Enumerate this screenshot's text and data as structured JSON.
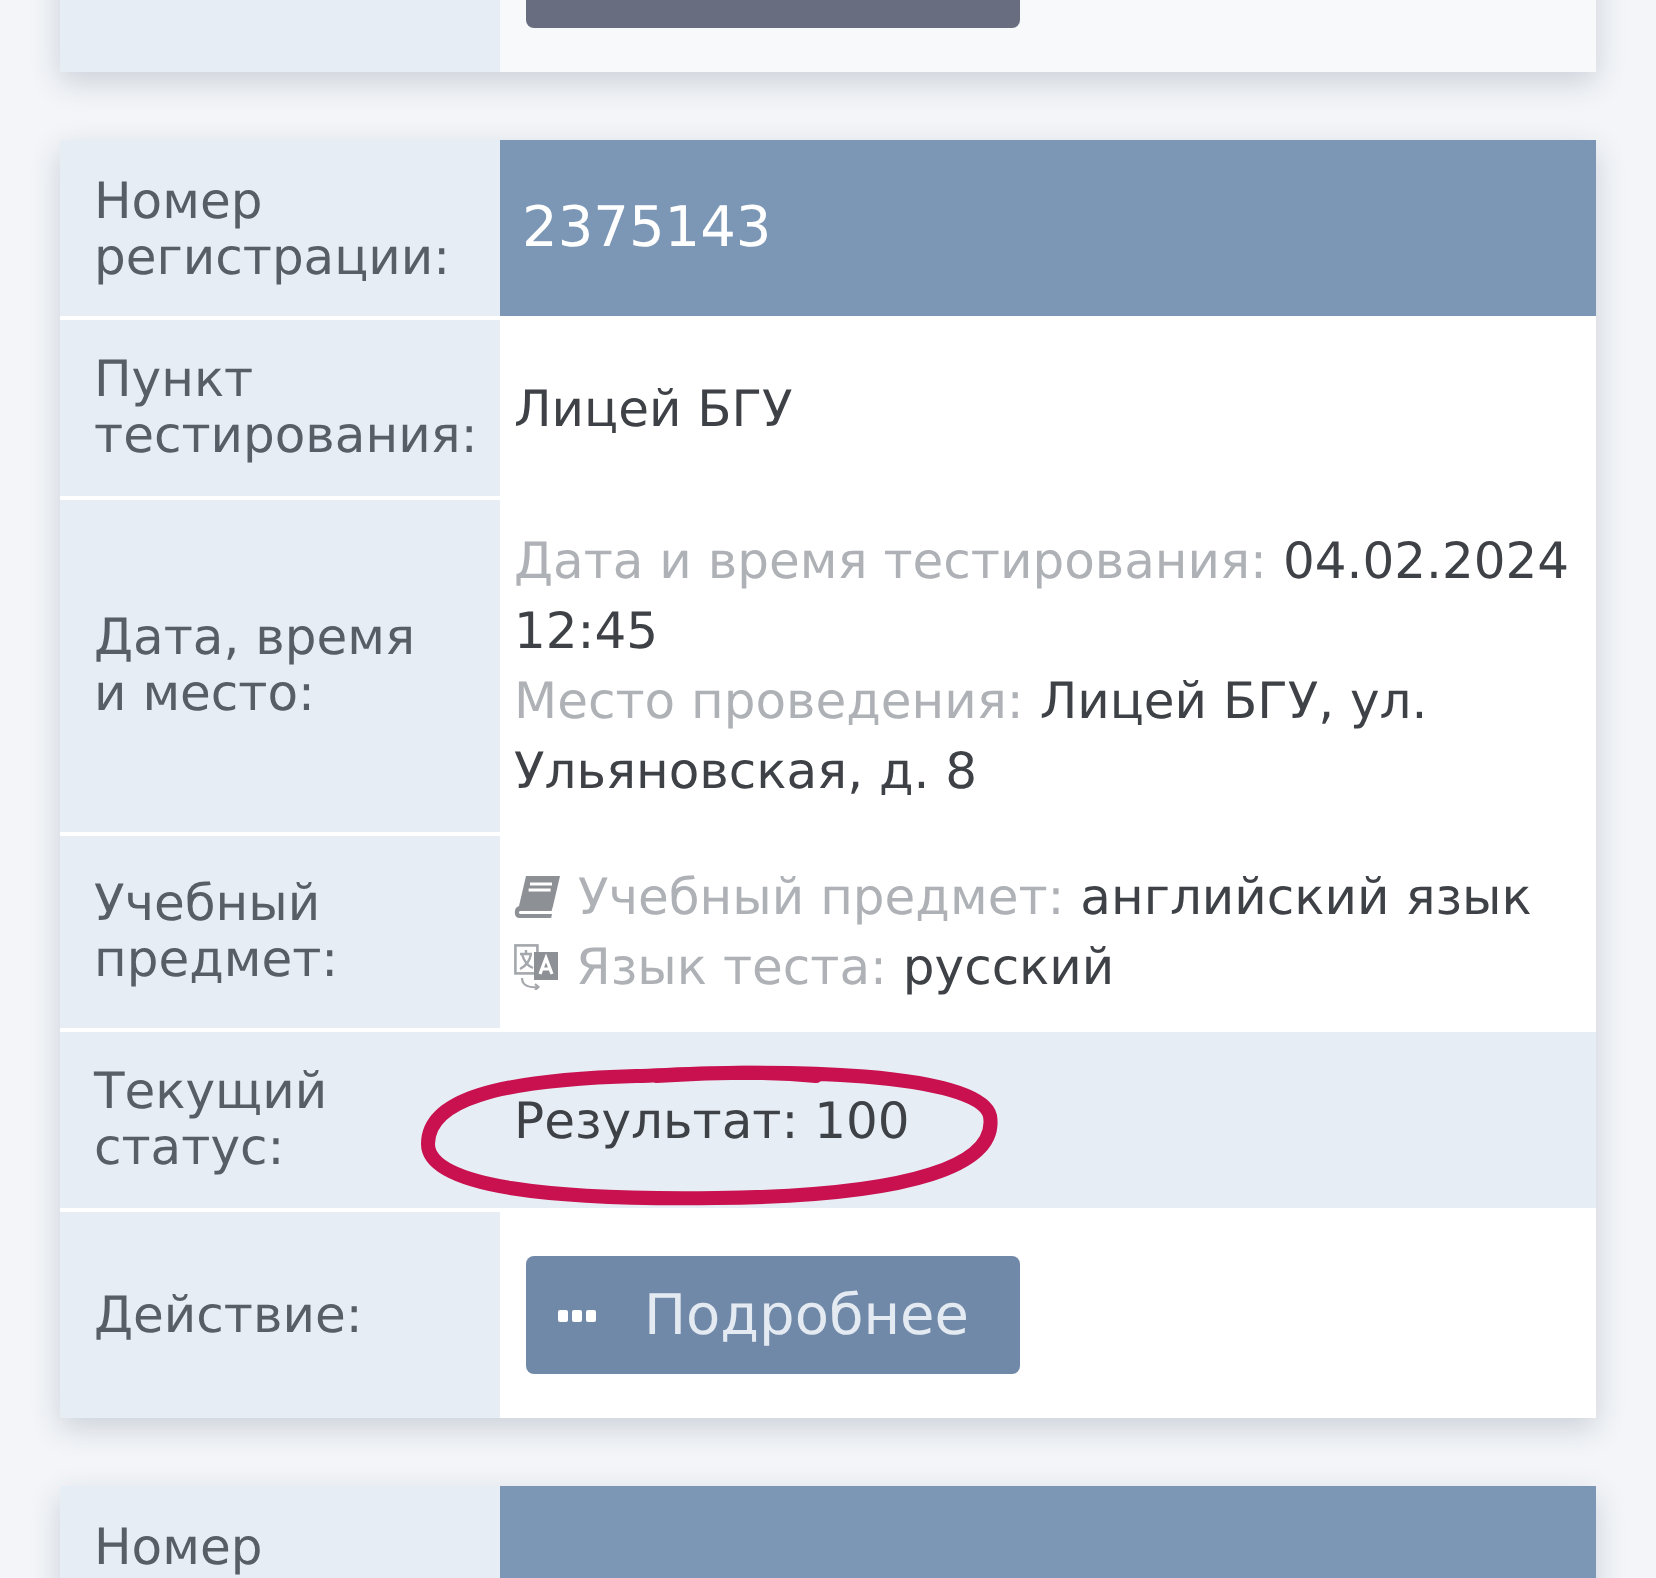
{
  "cards": [
    {
      "rows": [
        {
          "kind": "action",
          "hovered": true
        }
      ]
    },
    {
      "rows": [
        {
          "kind": "number",
          "label": "Номер регистрации:",
          "value": "2375143"
        },
        {
          "kind": "text",
          "label": "Пункт тестирования:",
          "value": "Лицей БГУ"
        },
        {
          "kind": "details",
          "label": "Дата, время и место:",
          "lines": [
            {
              "kind": "date",
              "caption": "Дата и время тестирования:",
              "value": "04.02.2024 12:45"
            },
            {
              "kind": "place",
              "caption": "Место проведения:",
              "value": "Лицей БГУ, ул. Ульяновская, д. 8"
            }
          ]
        },
        {
          "kind": "details",
          "label": "Учебный предмет:",
          "lines": [
            {
              "kind": "subject",
              "caption": "Учебный предмет:",
              "value": "английский язык"
            },
            {
              "kind": "language",
              "caption": "Язык теста:",
              "value": "русский"
            }
          ]
        },
        {
          "kind": "status",
          "label": "Текущий статус:",
          "value": "Результат: 100",
          "highlighted": true
        },
        {
          "kind": "action",
          "label": "Действие:",
          "hovered": false,
          "button": {
            "label": "Подробнее"
          }
        }
      ]
    },
    {
      "rows": [
        {
          "kind": "number",
          "label": "Номер"
        }
      ]
    }
  ]
}
